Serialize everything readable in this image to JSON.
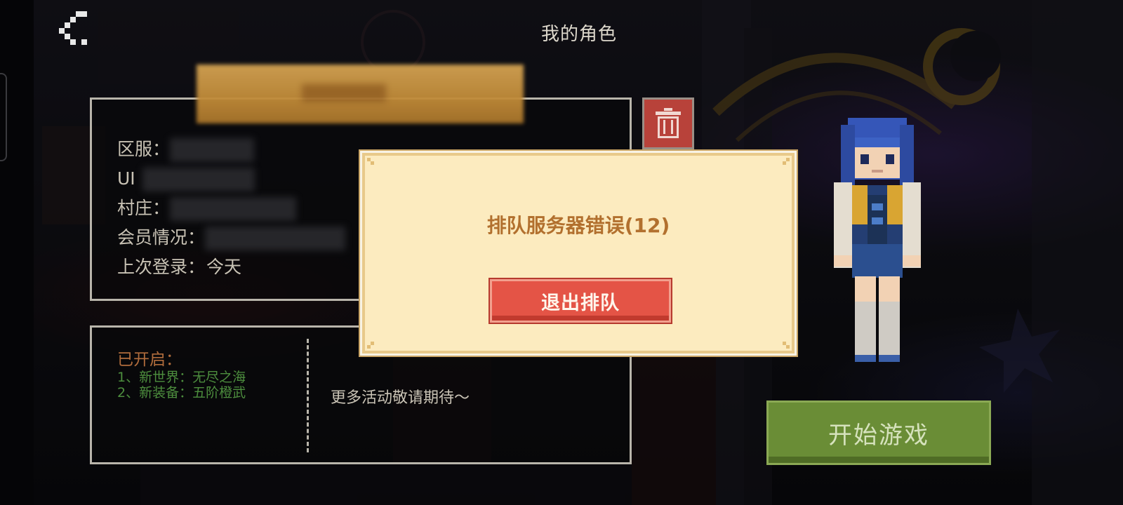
{
  "header": {
    "title": "我的角色",
    "back_icon": "chevron-left-icon"
  },
  "character": {
    "rows": [
      {
        "label": "区服：",
        "value": ""
      },
      {
        "label": "UI",
        "value": ""
      },
      {
        "label": "村庄：",
        "value": ""
      },
      {
        "label": "会员情况：",
        "value": ""
      },
      {
        "label": "上次登录：",
        "value": "今天"
      }
    ],
    "delete_icon": "trash-icon"
  },
  "events": {
    "opened_label": "已开启：",
    "items": [
      "1、新世界：无尽之海",
      "2、新装备：五阶橙武"
    ],
    "more_text": "更多活动敬请期待～"
  },
  "start_button": {
    "label": "开始游戏"
  },
  "modal": {
    "message": "排队服务器错误(12)",
    "button_label": "退出排队"
  },
  "colors": {
    "modal_bg": "#fcebbf",
    "modal_text": "#b2702e",
    "exit_button": "#e45446",
    "start_button": "#6a8d36",
    "delete_button": "#b8423a",
    "event_green": "#4d8e3e",
    "event_orange": "#b06c3c"
  }
}
